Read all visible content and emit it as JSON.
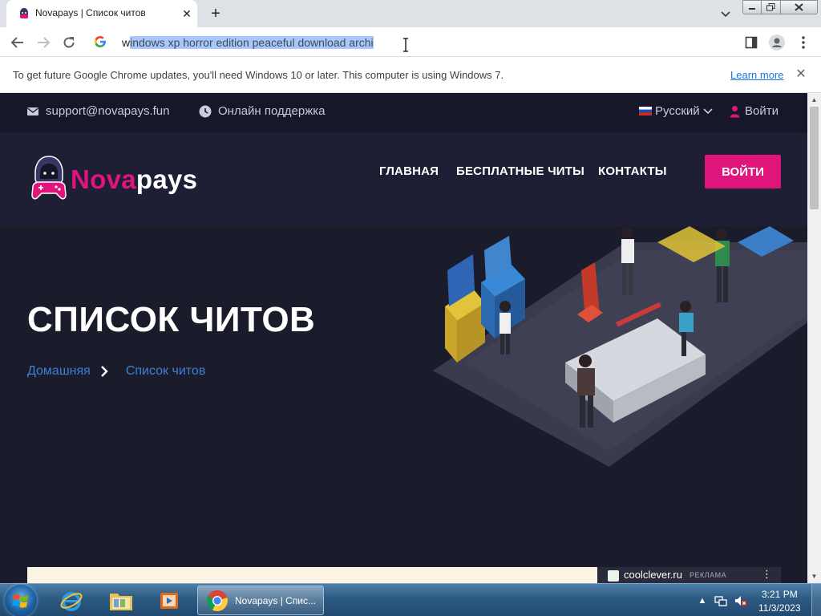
{
  "browser": {
    "tab": {
      "title": "Novapays | Список читов",
      "close": "✕"
    },
    "new_tab": "+",
    "omnibox": {
      "text_prefix": "w",
      "text_selected": "indows xp horror edition peaceful download archi"
    },
    "infobar": {
      "message": "To get future Google Chrome updates, you'll need Windows 10 or later. This computer is using Windows 7.",
      "link": "Learn more",
      "close": "✕"
    }
  },
  "site": {
    "topbar": {
      "email": "support@novapays.fun",
      "support": "Онлайн поддержка",
      "language": "Русский",
      "login": "Войти"
    },
    "logo": {
      "part1": "Nova",
      "part2": "pays"
    },
    "nav": {
      "home": "ГЛАВНАЯ",
      "free_cheats": "БЕСПЛАТНЫЕ ЧИТЫ",
      "contacts": "КОНТАКТЫ",
      "login_button": "ВОЙТИ"
    },
    "hero": {
      "title": "СПИСОК ЧИТОВ",
      "breadcrumb_home": "Домашняя",
      "breadcrumb_current": "Список читов"
    },
    "ad": {
      "domain": "coolclever.ru",
      "tag": "РЕКЛАМА",
      "more": "⋮"
    }
  },
  "taskbar": {
    "task_label": "Novapays | Спис...",
    "time": "3:21 PM",
    "date": "11/3/2023"
  },
  "colors": {
    "accent": "#e0157c",
    "page_bg": "#1a1c2c",
    "link": "#3f7ed8"
  }
}
